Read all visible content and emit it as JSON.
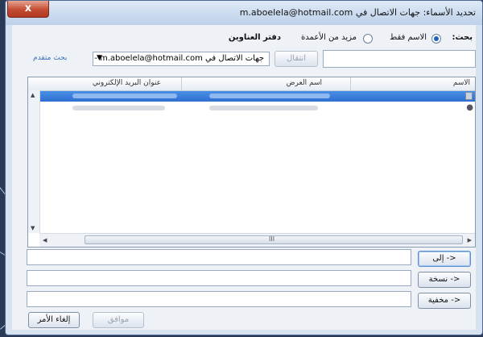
{
  "window": {
    "title": "تحديد الأسماء: جهات الاتصال في m.aboelela@hotmail.com",
    "close_label": "x"
  },
  "search": {
    "label": "بحث:",
    "option_name_only": "الاسم فقط",
    "option_more_columns": "مزيد من الأعمدة",
    "selected_option": "الاسم فقط",
    "address_book_label": "دفتر العناوين",
    "query_value": "",
    "go_button": "انتقال",
    "address_book_value": "جهات الاتصال في m.aboelela@hotmail.com - ח",
    "advanced_find": "بحث متقدم"
  },
  "contacts": {
    "columns": [
      "الاسم",
      "اسم العرض",
      "عنوان البريد الإلكتروني"
    ],
    "rows": [
      {
        "selected": true,
        "icon": "contact-group-icon"
      },
      {
        "selected": false,
        "icon": "contact-person-icon"
      }
    ],
    "hscroll_grip": "III"
  },
  "recipients": {
    "to_button": "إلى ->",
    "to_value": "",
    "cc_button": "نسخة ->",
    "cc_value": "",
    "bcc_button": "مخفية ->",
    "bcc_value": ""
  },
  "footer": {
    "ok_button": "موافق",
    "cancel_button": "إلغاء الأمر"
  },
  "colors": {
    "background": "#2a3a55",
    "title_gradient_top": "#dde9f7",
    "close_button": "#c44b32",
    "selection": "#2d6fd0",
    "link": "#3a6fb8"
  }
}
